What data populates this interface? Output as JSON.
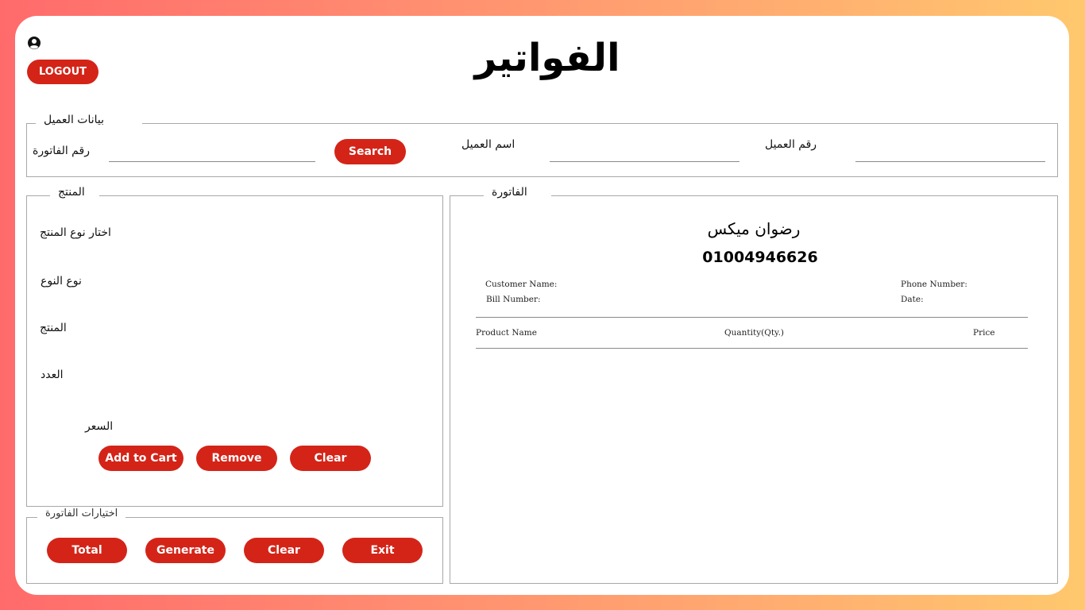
{
  "header": {
    "title": "الفواتير",
    "logout_label": "LOGOUT",
    "user_icon": "user-circle-icon"
  },
  "customer_section": {
    "legend": "بيانات العميل",
    "bill_number_label": "رقم الفاتورة",
    "bill_number_value": "",
    "search_label": "Search",
    "customer_name_label": "اسم العميل",
    "customer_name_value": "",
    "customer_phone_label": "رقم العميل",
    "customer_phone_value": ""
  },
  "product_section": {
    "legend": "المنتج",
    "product_category_label": "اختار نوع المنتج",
    "type_label": "نوع النوع",
    "product_label": "المنتج",
    "quantity_label": "العدد",
    "price_label": "السعر",
    "add_to_cart_label": "Add to Cart",
    "remove_label": "Remove",
    "clear_label": "Clear"
  },
  "bill_options": {
    "legend": "اختيارات الفاتورة",
    "total_label": "Total",
    "generate_label": "Generate",
    "clear_label": "Clear",
    "exit_label": "Exit"
  },
  "invoice": {
    "legend": "الفاتورة",
    "shop_name": "رضوان ميكس",
    "shop_phone": "01004946626",
    "customer_name_label": "Customer Name:",
    "bill_number_label": "Bill Number:",
    "phone_number_label": "Phone Number:",
    "date_label": "Date:",
    "columns": [
      "Product Name",
      "Quantity(Qty.)",
      "Price"
    ]
  },
  "colors": {
    "accent": "#d42418",
    "border": "#a8a8a8"
  }
}
